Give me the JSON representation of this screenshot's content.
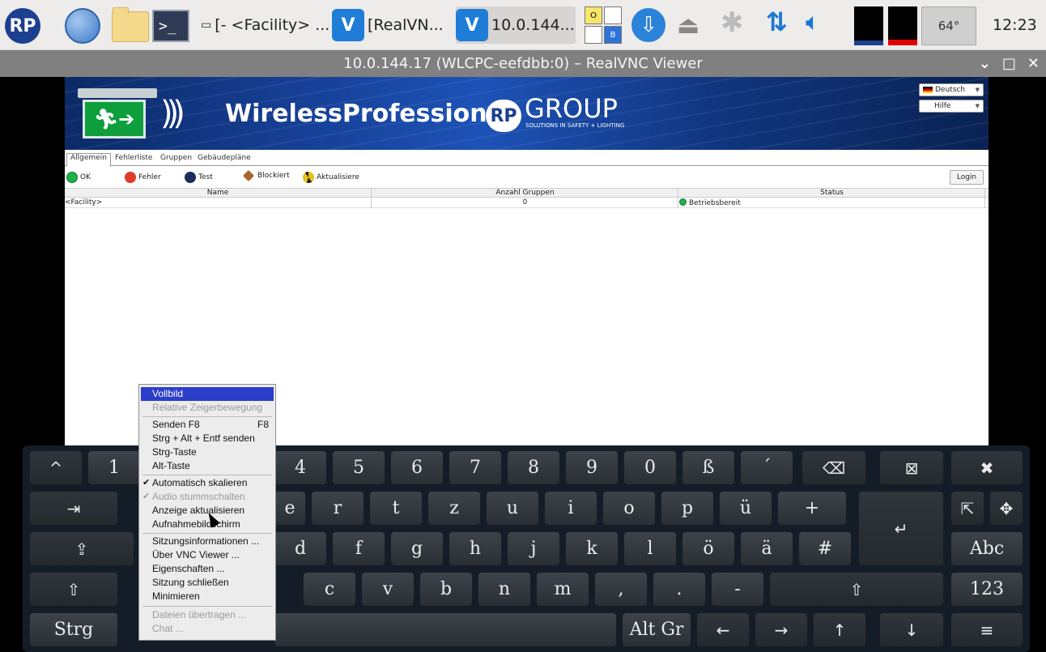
{
  "taskbar": {
    "logo": "RP",
    "terminal_prompt": ">_",
    "tasks": [
      {
        "label": "[- <Facility> ...",
        "icon": "window-icon"
      },
      {
        "label": "[RealVN...",
        "icon": "realvnc-icon"
      },
      {
        "label": "10.0.144...",
        "icon": "realvnc-icon",
        "active": true
      }
    ],
    "vnc_icon_text": "V",
    "kb_cells": [
      "O",
      "",
      "",
      "B"
    ],
    "cpu_label": "64°",
    "clock": "12:23"
  },
  "window": {
    "title": "10.0.144.17 (WLCPC-eefdbb:0) – RealVNC Viewer",
    "controls": [
      "⌄",
      "□",
      "✕"
    ]
  },
  "remote_app": {
    "brand": "WirelessProfessional",
    "rp_mark": "RP",
    "group": "GROUP",
    "group_sub": "SOLUTIONS IN SAFETY + LIGHTING",
    "language": "Deutsch",
    "help": "Hilfe",
    "tabs": [
      "Allgemein",
      "Fehlerliste",
      "Gruppen",
      "Gebäudepläne"
    ],
    "toolbar": {
      "ok": "OK",
      "error": "Fehler",
      "test": "Test",
      "blocked": "Blockiert",
      "refresh": "Aktualisiere",
      "login": "Login"
    },
    "table": {
      "headers": [
        "Name",
        "Anzahl Gruppen",
        "Status"
      ],
      "rows": [
        {
          "name": "<Facility>",
          "groups": "0",
          "status": "Betriebsbereit"
        }
      ]
    }
  },
  "keyboard": {
    "row1": [
      "^",
      "1",
      "4",
      "5",
      "6",
      "7",
      "8",
      "9",
      "0",
      "ß",
      "´",
      "⌫",
      "⊠",
      "✖"
    ],
    "row2": [
      "⇥",
      "e",
      "r",
      "t",
      "z",
      "u",
      "i",
      "o",
      "p",
      "ü",
      "+",
      "↵",
      "⇱",
      "✥"
    ],
    "row3": [
      "⇪",
      "d",
      "f",
      "g",
      "h",
      "j",
      "k",
      "l",
      "ö",
      "ä",
      "#",
      "Abc"
    ],
    "row4": [
      "⇧",
      "c",
      "v",
      "b",
      "n",
      "m",
      ",",
      ".",
      "-",
      "⇧",
      "123"
    ],
    "row5": [
      "Strg",
      "",
      "Alt Gr",
      "←",
      "→",
      "↑",
      "↓",
      "≡"
    ]
  },
  "menu": {
    "items": [
      {
        "label": "Vollbild",
        "highlighted": true
      },
      {
        "label": "Relative Zeigerbewegung",
        "disabled": true
      },
      {
        "label": "Senden F8",
        "shortcut": "F8"
      },
      {
        "label": "Strg + Alt + Entf senden"
      },
      {
        "label": "Strg-Taste"
      },
      {
        "label": "Alt-Taste"
      },
      {
        "label": "Automatisch skalieren",
        "checked": true
      },
      {
        "label": "Audio stummschalten",
        "checked": true,
        "disabled": true
      },
      {
        "label": "Anzeige aktualisieren"
      },
      {
        "label": "Aufnahmebildschirm"
      },
      {
        "label": "Sitzungsinformationen ..."
      },
      {
        "label": "Über VNC Viewer ..."
      },
      {
        "label": "Eigenschaften ..."
      },
      {
        "label": "Sitzung schließen"
      },
      {
        "label": "Minimieren"
      },
      {
        "label": "Dateien übertragen ...",
        "disabled": true
      },
      {
        "label": "Chat ...",
        "disabled": true
      }
    ],
    "checkmark": "✔"
  }
}
